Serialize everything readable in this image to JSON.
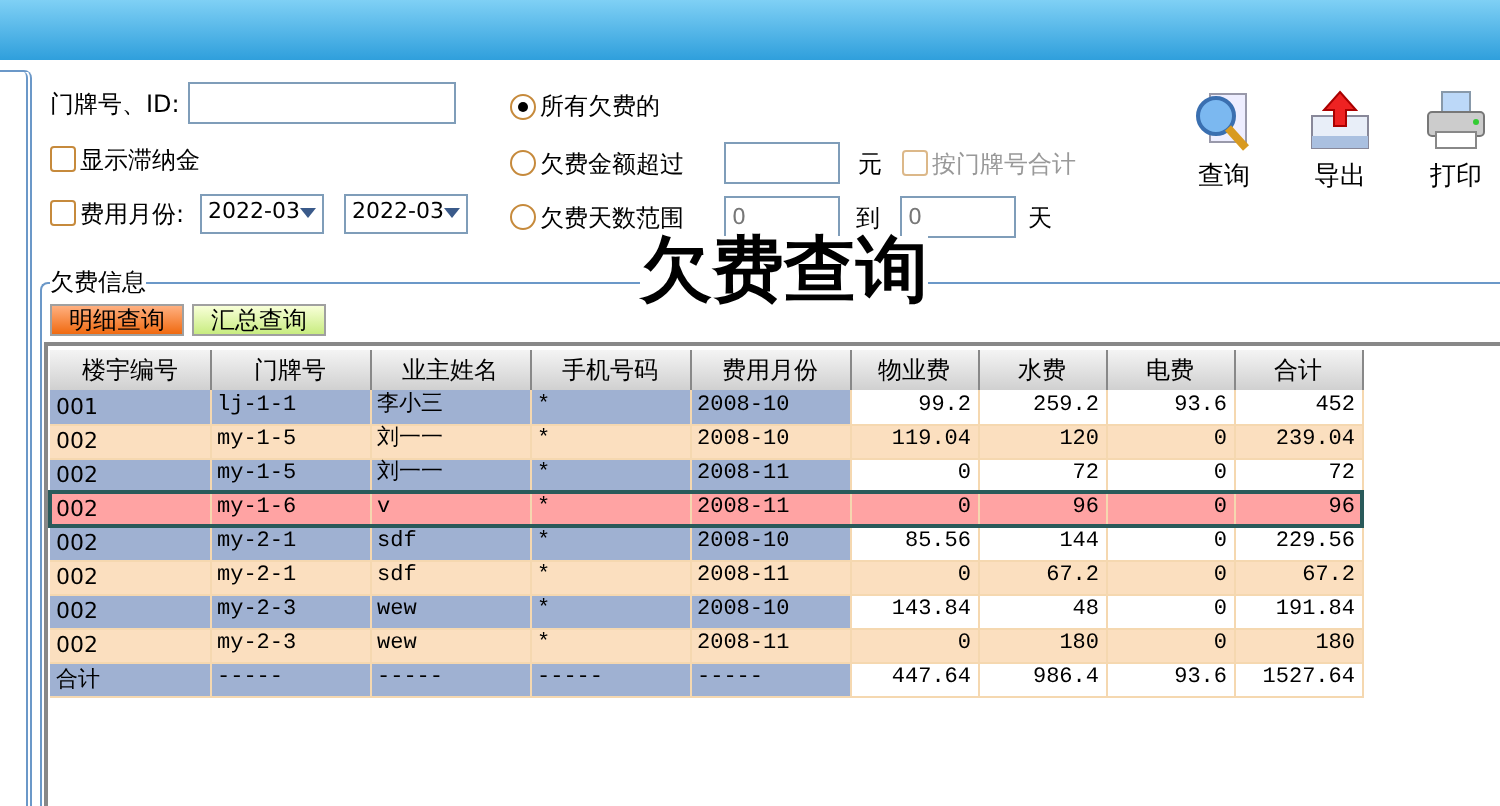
{
  "filter": {
    "id_label": "门牌号、ID:",
    "late_fee": {
      "label": "显示滞纳金",
      "checked": false
    },
    "month": {
      "label": "费用月份:",
      "checked": false,
      "from": "2022-03",
      "to": "2022-03"
    }
  },
  "modes": [
    {
      "kind": "all",
      "label": "所有欠费的",
      "selected": true
    },
    {
      "kind": "amount",
      "label": "欠费金额超过",
      "selected": false,
      "unit": "元",
      "option": {
        "label": "按门牌号合计",
        "checked": false,
        "disabled": true
      }
    },
    {
      "kind": "days",
      "label": "欠费天数范围",
      "selected": false,
      "from": "0",
      "to_label": "到",
      "to": "0",
      "unit": "天"
    }
  ],
  "toolbar": [
    {
      "kind": "search",
      "label": "查询"
    },
    {
      "kind": "export",
      "label": "导出"
    },
    {
      "kind": "print",
      "label": "打印"
    }
  ],
  "title": "欠费查询",
  "group_label": "欠费信息",
  "tabs": [
    {
      "label": "明细查询",
      "selected": true
    },
    {
      "label": "汇总查询",
      "selected": false
    }
  ],
  "table": {
    "columns": [
      "楼宇编号",
      "门牌号",
      "业主姓名",
      "手机号码",
      "费用月份",
      "物业费",
      "水费",
      "电费",
      "合计"
    ],
    "rows": [
      {
        "kind": "data",
        "selected": false,
        "cells": [
          "001",
          "lj-1-1",
          "李小三",
          "*",
          "2008-10",
          "99.2",
          "259.2",
          "93.6",
          "452"
        ]
      },
      {
        "kind": "data",
        "selected": false,
        "cells": [
          "002",
          "my-1-5",
          "刘一一",
          "*",
          "2008-10",
          "119.04",
          "120",
          "0",
          "239.04"
        ]
      },
      {
        "kind": "data",
        "selected": false,
        "cells": [
          "002",
          "my-1-5",
          "刘一一",
          "*",
          "2008-11",
          "0",
          "72",
          "0",
          "72"
        ]
      },
      {
        "kind": "data",
        "selected": true,
        "cells": [
          "002",
          "my-1-6",
          "v",
          "*",
          "2008-11",
          "0",
          "96",
          "0",
          "96"
        ]
      },
      {
        "kind": "data",
        "selected": false,
        "cells": [
          "002",
          "my-2-1",
          "sdf",
          "*",
          "2008-10",
          "85.56",
          "144",
          "0",
          "229.56"
        ]
      },
      {
        "kind": "data",
        "selected": false,
        "cells": [
          "002",
          "my-2-1",
          "sdf",
          "*",
          "2008-11",
          "0",
          "67.2",
          "0",
          "67.2"
        ]
      },
      {
        "kind": "data",
        "selected": false,
        "cells": [
          "002",
          "my-2-3",
          "wew",
          "*",
          "2008-10",
          "143.84",
          "48",
          "0",
          "191.84"
        ]
      },
      {
        "kind": "data",
        "selected": false,
        "cells": [
          "002",
          "my-2-3",
          "wew",
          "*",
          "2008-11",
          "0",
          "180",
          "0",
          "180"
        ]
      },
      {
        "kind": "total",
        "selected": false,
        "cells": [
          "合计",
          "-----",
          "-----",
          "-----",
          "-----",
          "447.64",
          "986.4",
          "93.6",
          "1527.64"
        ]
      }
    ]
  }
}
